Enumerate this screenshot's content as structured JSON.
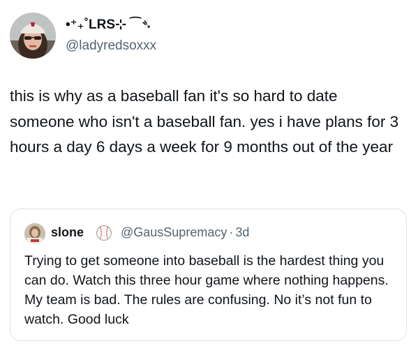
{
  "tweet": {
    "display_name": "•⁺₊˚LRS⊹ ⁀➴",
    "handle": "@ladyredsoxxx",
    "text": "this is why as a baseball fan it's so hard to date someone who isn't a baseball fan. yes i have plans for 3 hours a day 6 days a week for 9 months out of the year",
    "avatar_icon": "profile-photo"
  },
  "quoted_tweet": {
    "display_name": "slone",
    "badge_icon": "baseball-icon",
    "handle": "@GausSupremacy",
    "separator": "·",
    "time": "3d",
    "text": "Trying to get someone into baseball is the hardest thing you can do. Watch this three hour game where nothing happens. My team is bad. The rules are confusing. No it’s not fun to watch. Good luck"
  },
  "colors": {
    "text": "#0f1419",
    "secondary": "#536471",
    "border": "#dfe3e6",
    "baseball_stitch": "#d0312d"
  }
}
